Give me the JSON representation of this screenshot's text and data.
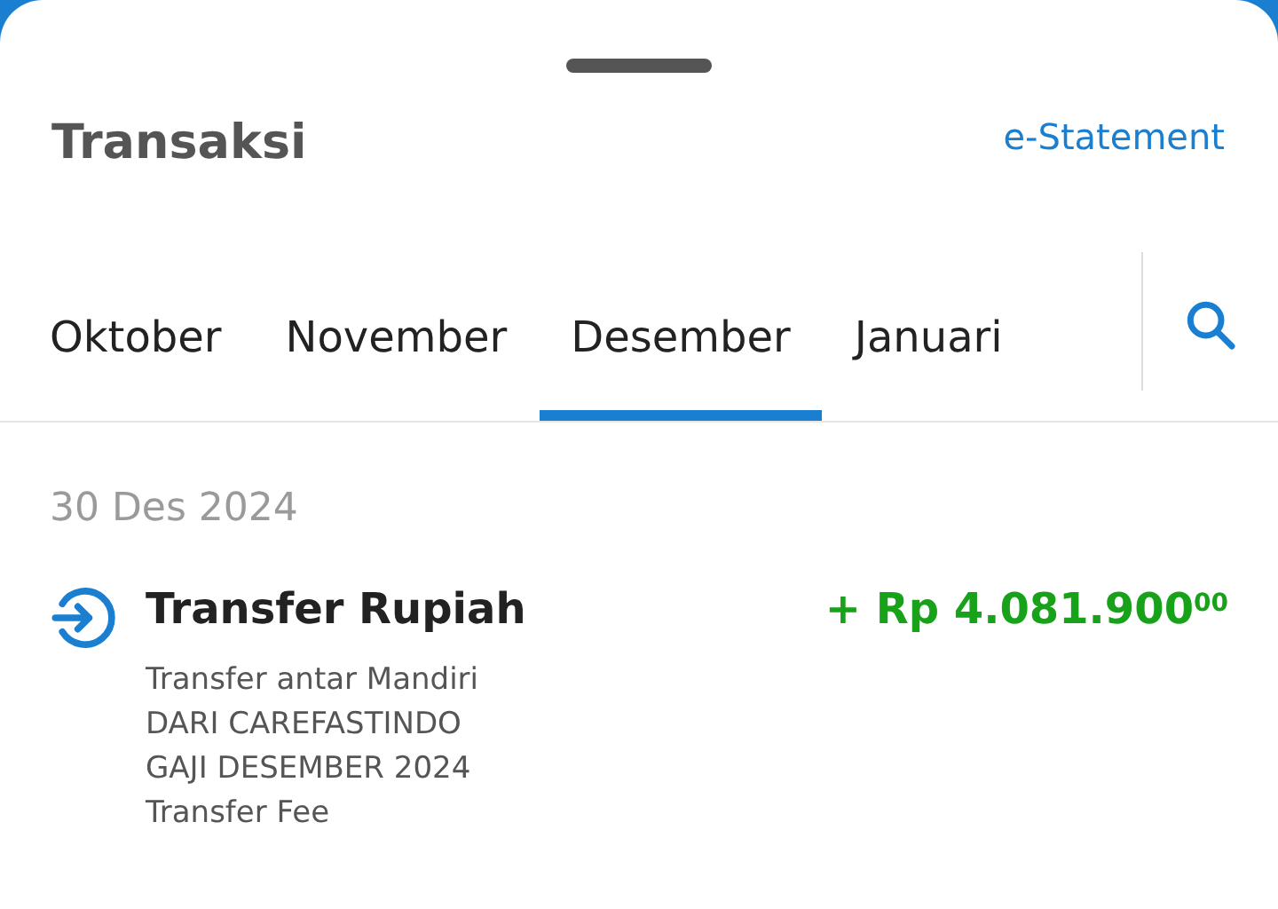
{
  "header": {
    "title": "Transaksi",
    "link": "e-Statement"
  },
  "tabs": [
    {
      "label": "Oktober",
      "selected": false
    },
    {
      "label": "November",
      "selected": false
    },
    {
      "label": "Desember",
      "selected": true
    },
    {
      "label": "Januari",
      "selected": false
    }
  ],
  "groups": [
    {
      "date": "30 Des 2024",
      "transactions": [
        {
          "title": "Transfer Rupiah",
          "amount": "+ Rp 4.081.900$^{00}$",
          "details": [
            "Transfer antar Mandiri",
            "DARI CAREFASTINDO",
            "GAJI DESEMBER 2024",
            "Transfer Fee"
          ]
        }
      ]
    }
  ]
}
